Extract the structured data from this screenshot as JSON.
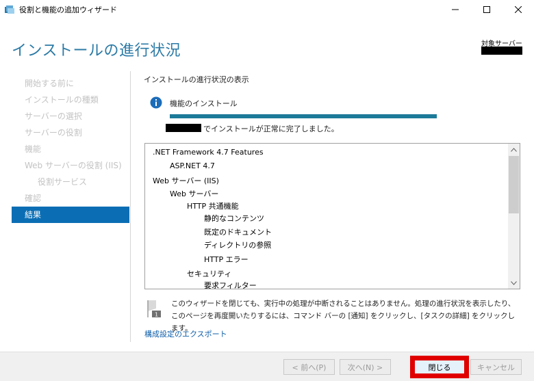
{
  "window": {
    "title": "役割と機能の追加ウィザード"
  },
  "header": {
    "title": "インストールの進行状況",
    "target_server_label": "対象サーバー"
  },
  "nav": {
    "items": [
      {
        "label": "開始する前に"
      },
      {
        "label": "インストールの種類"
      },
      {
        "label": "サーバーの選択"
      },
      {
        "label": "サーバーの役割"
      },
      {
        "label": "機能"
      },
      {
        "label": "Web サーバーの役割 (IIS)"
      },
      {
        "label": "役割サービス"
      },
      {
        "label": "確認"
      },
      {
        "label": "結果"
      }
    ]
  },
  "main": {
    "section_title": "インストールの進行状況の表示",
    "install_label": "機能のインストール",
    "progress": 1.0,
    "success_text": "でインストールが正常に完了しました。",
    "features": [
      {
        "label": ".NET Framework 4.7 Features",
        "level": 0
      },
      {
        "label": "ASP.NET 4.7",
        "level": 1
      },
      {
        "label": "Web サーバー (IIS)",
        "level": 0
      },
      {
        "label": "Web サーバー",
        "level": 1
      },
      {
        "label": "HTTP 共通機能",
        "level": 2
      },
      {
        "label": "静的なコンテンツ",
        "level": 3
      },
      {
        "label": "既定のドキュメント",
        "level": 3
      },
      {
        "label": "ディレクトリの参照",
        "level": 3
      },
      {
        "label": "HTTP エラー",
        "level": 3
      },
      {
        "label": "セキュリティ",
        "level": 2
      },
      {
        "label": "要求フィルター",
        "level": 3
      }
    ],
    "note": "このウィザードを閉じても、実行中の処理が中断されることはありません。処理の進行状況を表示したり、このページを再度開いたりするには、コマンド バーの [通知] をクリックし、[タスクの詳細] をクリックします。",
    "export_link": "構成設定のエクスポート"
  },
  "footer": {
    "prev": "< 前へ(P)",
    "next": "次へ(N) >",
    "close": "閉じる",
    "cancel": "キャンセル"
  },
  "colors": {
    "accent": "#0b6eb4",
    "progress": "#1d7a99",
    "highlight": "#e00000"
  }
}
